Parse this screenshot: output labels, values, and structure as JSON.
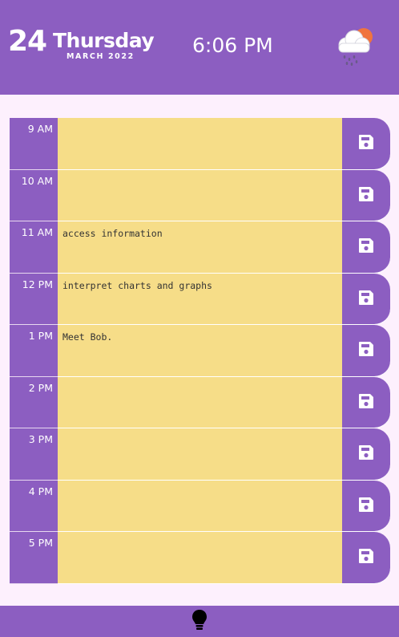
{
  "header": {
    "day_number": "24",
    "weekday": "Thursday",
    "month_year": "MARCH 2022",
    "time": "6:06 PM",
    "weather_icon": "cloud-rain-sun-icon"
  },
  "rows": [
    {
      "hour": "9 AM",
      "task": ""
    },
    {
      "hour": "10 AM",
      "task": ""
    },
    {
      "hour": "11 AM",
      "task": "access information"
    },
    {
      "hour": "12 PM",
      "task": "interpret charts and graphs"
    },
    {
      "hour": "1 PM",
      "task": "Meet Bob."
    },
    {
      "hour": "2 PM",
      "task": ""
    },
    {
      "hour": "3 PM",
      "task": ""
    },
    {
      "hour": "4 PM",
      "task": ""
    },
    {
      "hour": "5 PM",
      "task": ""
    }
  ],
  "footer": {
    "icon": "lightbulb-icon"
  },
  "colors": {
    "accent": "#8c5ec1",
    "task_bg": "#f6dd88",
    "page_bg": "#fdf0fd"
  }
}
